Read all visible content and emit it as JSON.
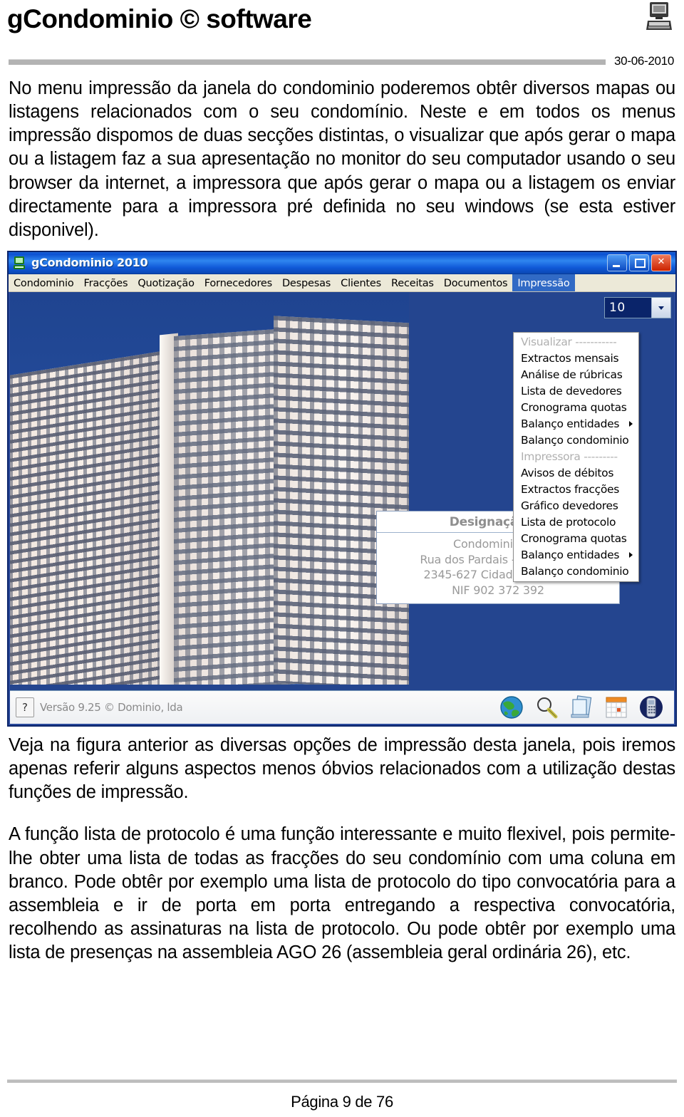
{
  "document": {
    "title": "gCondominio © software",
    "date": "30-06-2010",
    "header_icon": "computer-icon",
    "footer": "Página 9 de 76"
  },
  "paragraphs": {
    "p1": "No menu impressão da janela do condominio poderemos obtêr diversos mapas ou listagens relacionados com o seu condomínio. Neste e em todos os menus impressão dispomos de duas secções distintas, o visualizar que após gerar o mapa ou a listagem faz a sua apresentação no monitor do seu computador usando o seu browser da internet, a impressora que após gerar o mapa ou a listagem os enviar directamente para a impressora pré definida no seu windows (se esta estiver disponivel).",
    "p2": "Veja na figura anterior as diversas opções de impressão desta janela, pois iremos apenas referir alguns aspectos menos óbvios relacionados com a utilização destas funções de impressão.",
    "p3": "A função lista de protocolo é uma função interessante e muito flexivel, pois permite-lhe obter uma lista de todas as fracções do seu condomínio com uma coluna em branco. Pode obtêr por exemplo uma lista de protocolo do tipo convocatória para a assembleia e ir de porta em porta entregando a respectiva convocatória, recolhendo as assinaturas na lista de protocolo. Ou pode obtêr por exemplo uma lista de presenças na assembleia AGO 26 (assembleia geral ordinária 26), etc."
  },
  "app": {
    "titlebar": {
      "icon": "computer-icon",
      "title": "gCondominio 2010",
      "minimize_label": "Minimizar",
      "restore_label": "Restaurar",
      "close_label": "Fechar"
    },
    "menubar": [
      {
        "label": "Condominio",
        "active": false
      },
      {
        "label": "Fracções",
        "active": false
      },
      {
        "label": "Quotização",
        "active": false
      },
      {
        "label": "Fornecedores",
        "active": false
      },
      {
        "label": "Despesas",
        "active": false
      },
      {
        "label": "Clientes",
        "active": false
      },
      {
        "label": "Receitas",
        "active": false
      },
      {
        "label": "Documentos",
        "active": false
      },
      {
        "label": "Impressão",
        "active": true
      }
    ],
    "dropdown": {
      "items": [
        {
          "label": "Visualizar -----------",
          "group": true,
          "submenu": false
        },
        {
          "label": "Extractos mensais",
          "group": false,
          "submenu": false
        },
        {
          "label": "Análise de rúbricas",
          "group": false,
          "submenu": false
        },
        {
          "label": "Lista de devedores",
          "group": false,
          "submenu": false
        },
        {
          "label": "Cronograma quotas",
          "group": false,
          "submenu": false
        },
        {
          "label": "Balanço entidades",
          "group": false,
          "submenu": true
        },
        {
          "label": "Balanço condominio",
          "group": false,
          "submenu": false
        },
        {
          "label": "Impressora ---------",
          "group": true,
          "submenu": false
        },
        {
          "label": "Avisos de débitos",
          "group": false,
          "submenu": false
        },
        {
          "label": "Extractos fracções",
          "group": false,
          "submenu": false
        },
        {
          "label": "Gráfico devedores",
          "group": false,
          "submenu": false
        },
        {
          "label": "Lista de protocolo",
          "group": false,
          "submenu": false
        },
        {
          "label": "Cronograma quotas",
          "group": false,
          "submenu": false
        },
        {
          "label": "Balanço entidades",
          "group": false,
          "submenu": true
        },
        {
          "label": "Balanço condominio",
          "group": false,
          "submenu": false
        }
      ]
    },
    "year_combo": {
      "value": "10",
      "arrow_icon": "chevron-down-icon"
    },
    "address_panel": {
      "title": "Designação do",
      "lines": [
        "Condominio dos",
        "Rua dos Pardais - Ninho 102",
        "2345-627 Cidade das Aves",
        "NIF 902 372 392"
      ]
    },
    "statusbar": {
      "help_glyph": "?",
      "version": "Versão 9.25 © Dominio, lda",
      "icons": [
        "globe-icon",
        "magnifier-icon",
        "documents-icon",
        "calendar-icon",
        "phone-icon"
      ]
    },
    "colors": {
      "titlebar_blue": "#0a4fd0",
      "menu_highlight": "#316ac5",
      "client_background": "#24458f",
      "menubar_background": "#ece9d8",
      "close_button": "#cc2200"
    }
  }
}
